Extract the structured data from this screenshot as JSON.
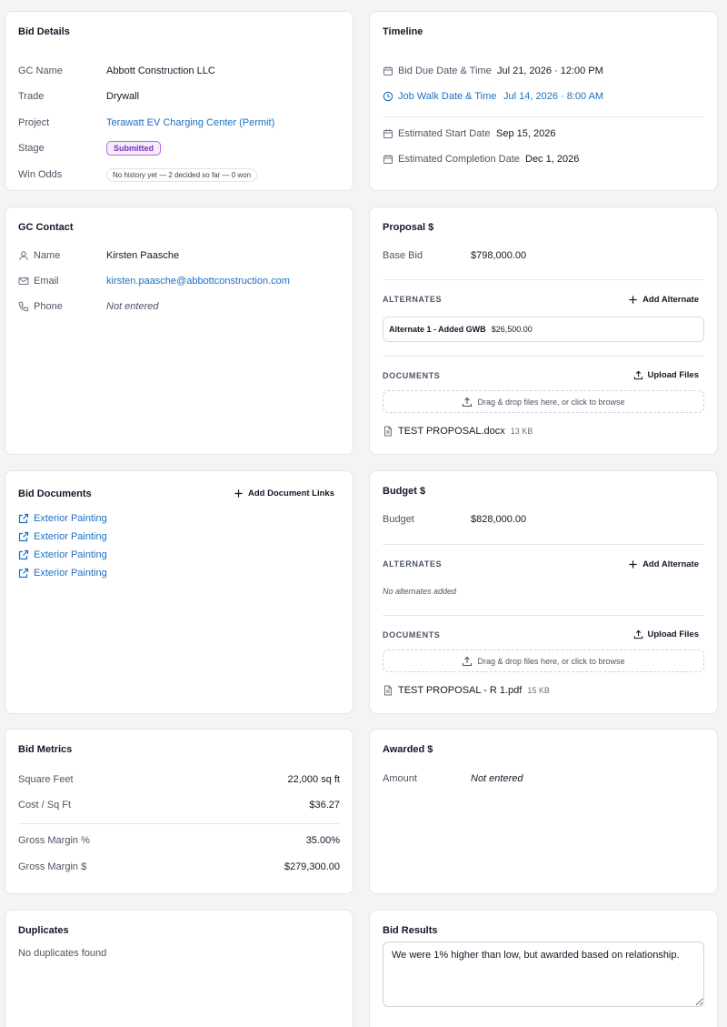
{
  "bid_details": {
    "title": "Bid Details",
    "gc_name_label": "GC Name",
    "gc_name": "Abbott Construction LLC",
    "trade_label": "Trade",
    "trade": "Drywall",
    "project_label": "Project",
    "project": "Terawatt EV Charging Center (Permit)",
    "stage_label": "Stage",
    "stage": "Submitted",
    "win_odds_label": "Win Odds",
    "win_odds": "No history yet — 2 decided so far — 0 won"
  },
  "timeline": {
    "title": "Timeline",
    "bid_due_label": "Bid Due Date & Time",
    "bid_due": "Jul 21, 2026 · 12:00 PM",
    "job_walk_label": "Job Walk Date & Time",
    "job_walk": "Jul 14, 2026 · 8:00 AM",
    "est_start_label": "Estimated Start Date",
    "est_start": "Sep 15, 2026",
    "est_completion_label": "Estimated Completion Date",
    "est_completion": "Dec 1, 2026"
  },
  "gc_contact": {
    "title": "GC Contact",
    "name_label": "Name",
    "name": "Kirsten Paasche",
    "email_label": "Email",
    "email": "kirsten.paasche@abbottconstruction.com",
    "phone_label": "Phone",
    "phone": "Not entered"
  },
  "proposal": {
    "title": "Proposal $",
    "base_bid_label": "Base Bid",
    "base_bid": "$798,000.00",
    "alternates_heading": "ALTERNATES",
    "add_alternate": "Add Alternate",
    "alternates": [
      {
        "name": "Alternate 1 - Added GWB",
        "amount": "$26,500.00"
      }
    ],
    "documents_heading": "DOCUMENTS",
    "upload_files": "Upload Files",
    "dropzone": "Drag & drop files here, or click to browse",
    "file": {
      "name": "TEST PROPOSAL.docx",
      "size": "13 KB"
    }
  },
  "bid_documents": {
    "title": "Bid Documents",
    "add_links": "Add Document Links",
    "links": [
      "Exterior Painting",
      "Exterior Painting",
      "Exterior Painting",
      "Exterior Painting"
    ]
  },
  "budget": {
    "title": "Budget $",
    "budget_label": "Budget",
    "budget": "$828,000.00",
    "alternates_heading": "ALTERNATES",
    "add_alternate": "Add Alternate",
    "no_alternates": "No alternates added",
    "documents_heading": "DOCUMENTS",
    "upload_files": "Upload Files",
    "dropzone": "Drag & drop files here, or click to browse",
    "file": {
      "name": "TEST PROPOSAL - R 1.pdf",
      "size": "15 KB"
    }
  },
  "bid_metrics": {
    "title": "Bid Metrics",
    "sqft_label": "Square Feet",
    "sqft": "22,000 sq ft",
    "cost_sqft_label": "Cost / Sq Ft",
    "cost_sqft": "$36.27",
    "gm_pct_label": "Gross Margin %",
    "gm_pct": "35.00%",
    "gm_usd_label": "Gross Margin $",
    "gm_usd": "$279,300.00"
  },
  "awarded": {
    "title": "Awarded $",
    "amount_label": "Amount",
    "amount": "Not entered"
  },
  "duplicates": {
    "title": "Duplicates",
    "message": "No duplicates found"
  },
  "bid_results": {
    "title": "Bid Results",
    "text": "We were 1% higher than low, but awarded based on relationship."
  },
  "colors": {
    "link": "#1d6fc2",
    "badge_border": "#b06be0",
    "badge_text": "#7e2fbf",
    "background": "#f3f4f6"
  }
}
